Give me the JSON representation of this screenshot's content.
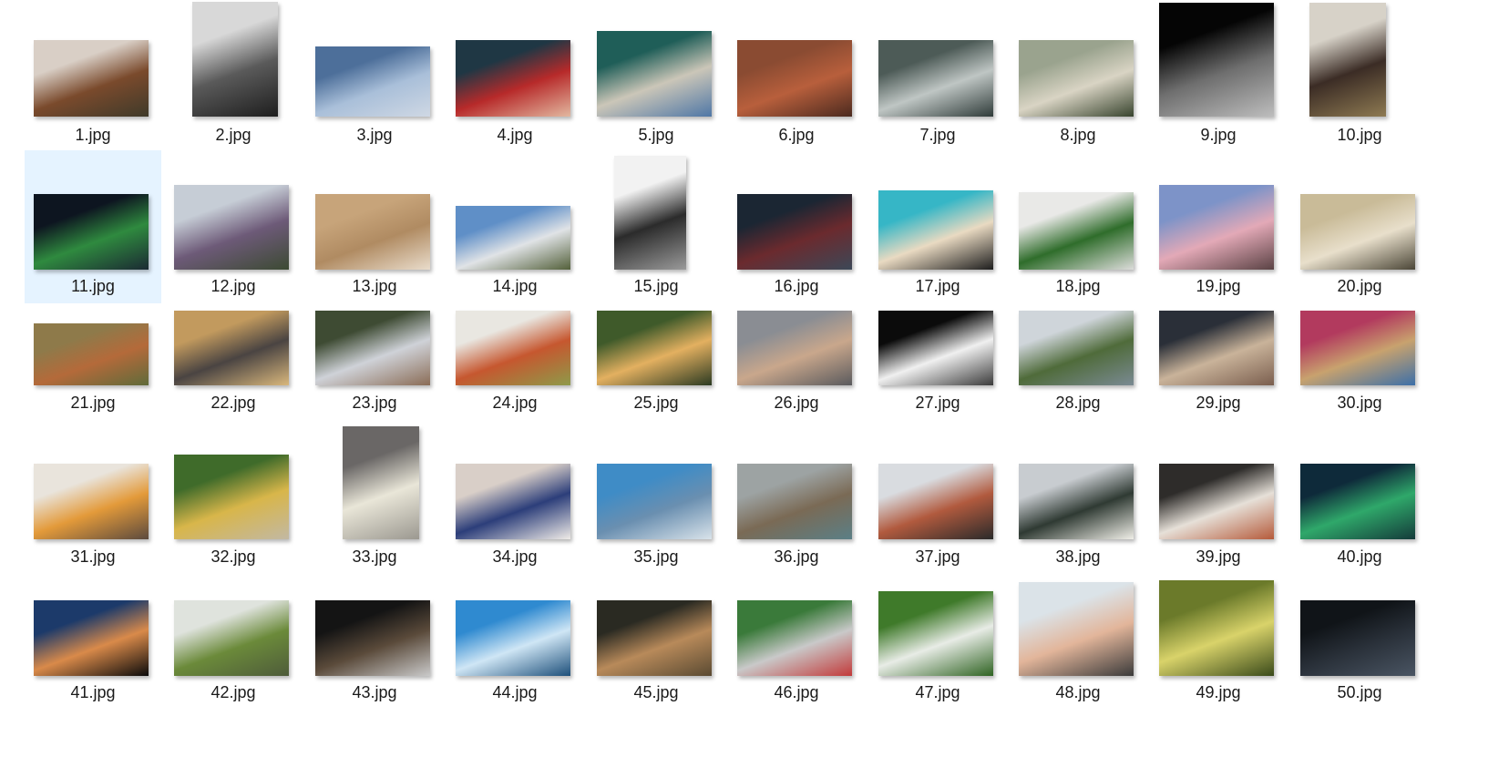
{
  "folder": {
    "selected_index": 10,
    "files": [
      {
        "name": "1.jpg",
        "colors": [
          "#d9cfc6",
          "#7a4a2c",
          "#3f3a2a"
        ]
      },
      {
        "name": "2.jpg",
        "colors": [
          "#d8d8d8",
          "#5a5a5a",
          "#1e1e1e"
        ]
      },
      {
        "name": "3.jpg",
        "colors": [
          "#4d6f9a",
          "#a9bfd9",
          "#cfd8e4"
        ]
      },
      {
        "name": "4.jpg",
        "colors": [
          "#1f3744",
          "#b72a2a",
          "#e2b8a0"
        ]
      },
      {
        "name": "5.jpg",
        "colors": [
          "#1f5e58",
          "#cbc6b8",
          "#4f77a6"
        ]
      },
      {
        "name": "6.jpg",
        "colors": [
          "#8a4b32",
          "#b85f3c",
          "#4b2a1f"
        ]
      },
      {
        "name": "7.jpg",
        "colors": [
          "#4d5b57",
          "#bfc6c4",
          "#2f3b39"
        ]
      },
      {
        "name": "8.jpg",
        "colors": [
          "#9aa38e",
          "#d9d4c4",
          "#38442e"
        ]
      },
      {
        "name": "9.jpg",
        "colors": [
          "#050505",
          "#6e6e6e",
          "#bdbdbd"
        ]
      },
      {
        "name": "10.jpg",
        "colors": [
          "#d7d2c8",
          "#3b2c25",
          "#8e7a52"
        ]
      },
      {
        "name": "11.jpg",
        "colors": [
          "#0d1520",
          "#2f8a3f",
          "#1b2a33"
        ]
      },
      {
        "name": "12.jpg",
        "colors": [
          "#c6cdd6",
          "#6d5a78",
          "#3c4a33"
        ]
      },
      {
        "name": "13.jpg",
        "colors": [
          "#c7a47a",
          "#b08b62",
          "#e9dccb"
        ]
      },
      {
        "name": "14.jpg",
        "colors": [
          "#5f8fc7",
          "#e0e3e6",
          "#53603a"
        ]
      },
      {
        "name": "15.jpg",
        "colors": [
          "#f2f2f2",
          "#2b2b2b",
          "#9a9a9a"
        ]
      },
      {
        "name": "16.jpg",
        "colors": [
          "#1b2633",
          "#6b2a2e",
          "#3c4857"
        ]
      },
      {
        "name": "17.jpg",
        "colors": [
          "#36b6c6",
          "#e9dac2",
          "#1d1d1d"
        ]
      },
      {
        "name": "18.jpg",
        "colors": [
          "#e9e9e7",
          "#2f6d2b",
          "#dcdcda"
        ]
      },
      {
        "name": "19.jpg",
        "colors": [
          "#7d93c8",
          "#e3a9b7",
          "#5a4244"
        ]
      },
      {
        "name": "20.jpg",
        "colors": [
          "#c9bb98",
          "#e8dfcb",
          "#4b4637"
        ]
      },
      {
        "name": "21.jpg",
        "colors": [
          "#8e7a4a",
          "#b46a3a",
          "#5f6b3a"
        ]
      },
      {
        "name": "22.jpg",
        "colors": [
          "#c29a5e",
          "#4a4442",
          "#d9b77c"
        ]
      },
      {
        "name": "23.jpg",
        "colors": [
          "#3e4b33",
          "#cfd2d8",
          "#8a6c56"
        ]
      },
      {
        "name": "24.jpg",
        "colors": [
          "#e9e7e1",
          "#c6572f",
          "#8e9a49"
        ]
      },
      {
        "name": "25.jpg",
        "colors": [
          "#3f5a2a",
          "#e3b060",
          "#2b3a22"
        ]
      },
      {
        "name": "26.jpg",
        "colors": [
          "#8a8d93",
          "#c9a78c",
          "#5a5a5d"
        ]
      },
      {
        "name": "27.jpg",
        "colors": [
          "#0b0b0b",
          "#f0f0f0",
          "#3a3a3a"
        ]
      },
      {
        "name": "28.jpg",
        "colors": [
          "#cfd5da",
          "#4f6b3a",
          "#7a8a93"
        ]
      },
      {
        "name": "29.jpg",
        "colors": [
          "#2a2f38",
          "#c9b39a",
          "#7a5e4e"
        ]
      },
      {
        "name": "30.jpg",
        "colors": [
          "#b23a5e",
          "#c8a26e",
          "#3c6fa8"
        ]
      },
      {
        "name": "31.jpg",
        "colors": [
          "#e9e4dc",
          "#e39a3a",
          "#5c4a3e"
        ]
      },
      {
        "name": "32.jpg",
        "colors": [
          "#3f6b2a",
          "#d8b64a",
          "#c2b8a3"
        ]
      },
      {
        "name": "33.jpg",
        "colors": [
          "#6a6766",
          "#e9e6d8",
          "#9b9890"
        ]
      },
      {
        "name": "34.jpg",
        "colors": [
          "#d9cfc8",
          "#2c3e7a",
          "#f0ece8"
        ]
      },
      {
        "name": "35.jpg",
        "colors": [
          "#3f8cc6",
          "#6a8fb0",
          "#d9e3ea"
        ]
      },
      {
        "name": "36.jpg",
        "colors": [
          "#9da3a3",
          "#7a6a55",
          "#5b7f86"
        ]
      },
      {
        "name": "37.jpg",
        "colors": [
          "#d9dce0",
          "#b15a3e",
          "#2a2a2a"
        ]
      },
      {
        "name": "38.jpg",
        "colors": [
          "#c8ccd0",
          "#2f3a33",
          "#f0efe8"
        ]
      },
      {
        "name": "39.jpg",
        "colors": [
          "#2e2c2a",
          "#e6e0d8",
          "#b55a3a"
        ]
      },
      {
        "name": "40.jpg",
        "colors": [
          "#0e2a3a",
          "#2fa86a",
          "#143b3a"
        ]
      },
      {
        "name": "41.jpg",
        "colors": [
          "#1c3a6a",
          "#d98a4a",
          "#0b0b0b"
        ]
      },
      {
        "name": "42.jpg",
        "colors": [
          "#dfe3dd",
          "#6b8a3a",
          "#4e5b3a"
        ]
      },
      {
        "name": "43.jpg",
        "colors": [
          "#141414",
          "#5a4a3a",
          "#c9c9c9"
        ]
      },
      {
        "name": "44.jpg",
        "colors": [
          "#2f8ad0",
          "#cfe6f5",
          "#1d4f7a"
        ]
      },
      {
        "name": "45.jpg",
        "colors": [
          "#2a2a22",
          "#b88a5a",
          "#5a4a32"
        ]
      },
      {
        "name": "46.jpg",
        "colors": [
          "#3a7a3a",
          "#c9c9c9",
          "#c23a3a"
        ]
      },
      {
        "name": "47.jpg",
        "colors": [
          "#3f7a2a",
          "#e8ece6",
          "#2f6322"
        ]
      },
      {
        "name": "48.jpg",
        "colors": [
          "#dbe3e8",
          "#e2b59a",
          "#3a3a3a"
        ]
      },
      {
        "name": "49.jpg",
        "colors": [
          "#6b7a2a",
          "#d9d36a",
          "#3a4a1a"
        ]
      },
      {
        "name": "50.jpg",
        "colors": [
          "#101418",
          "#2a313a",
          "#4a5563"
        ]
      }
    ]
  }
}
